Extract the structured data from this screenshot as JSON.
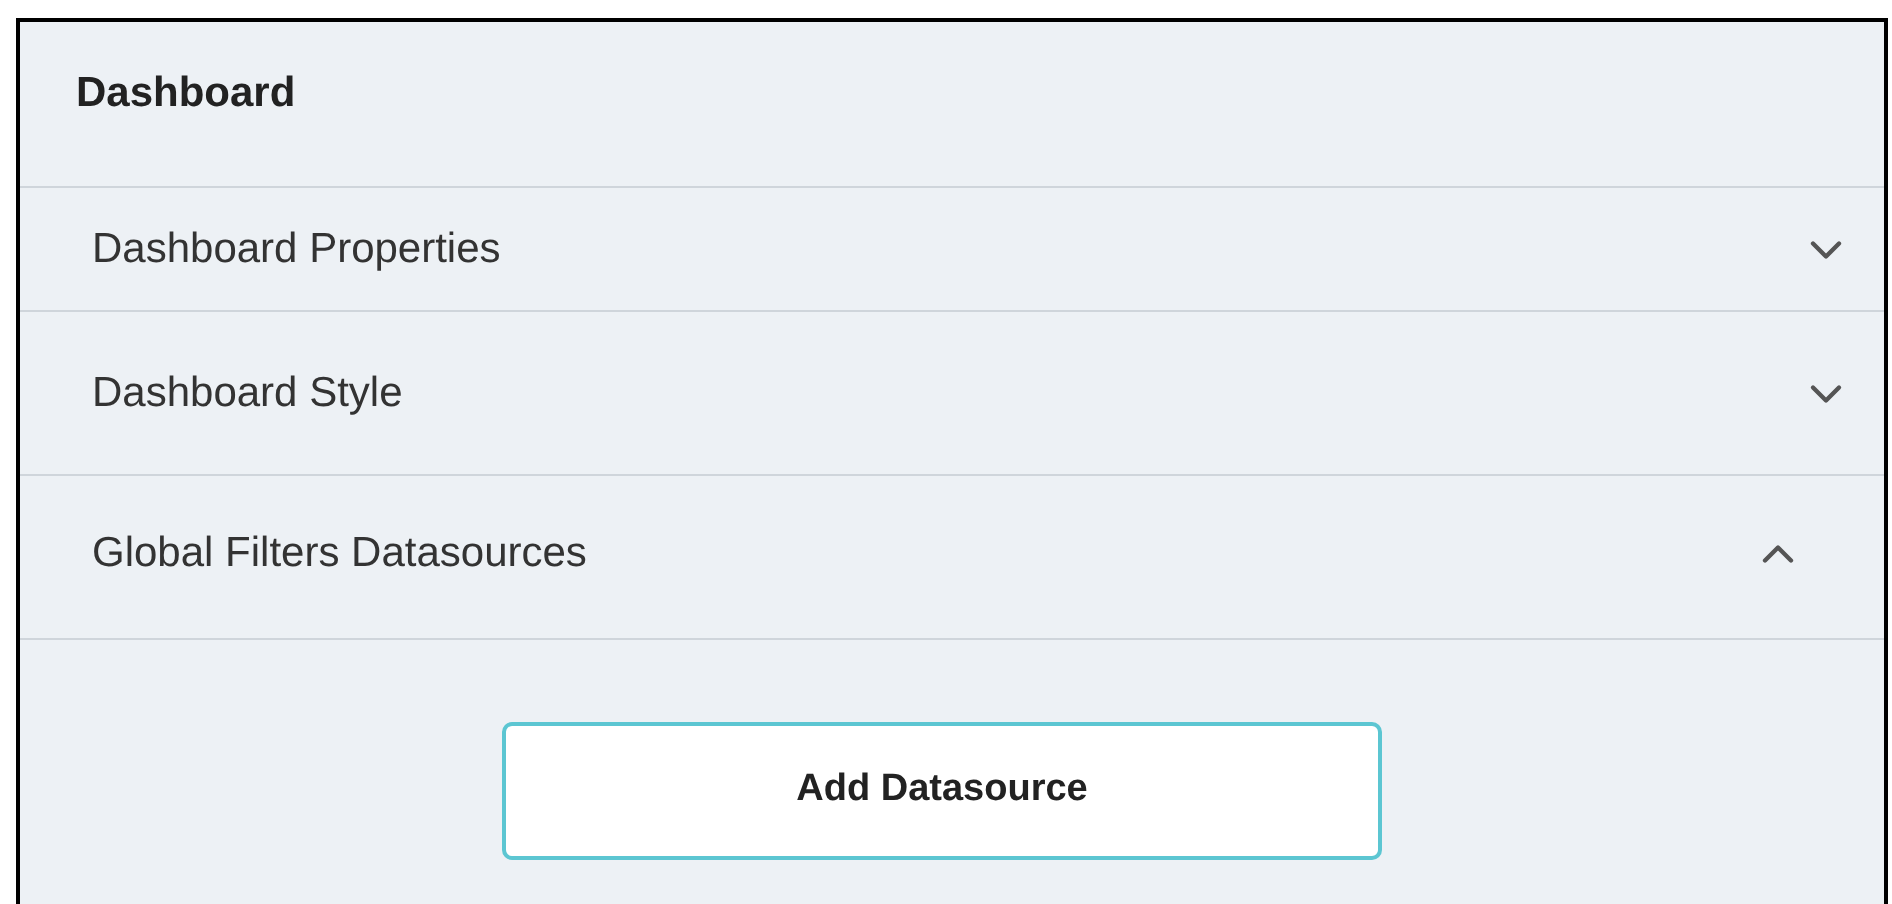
{
  "panel": {
    "title": "Dashboard"
  },
  "sections": [
    {
      "label": "Dashboard Properties",
      "expanded": false
    },
    {
      "label": "Dashboard Style",
      "expanded": false
    },
    {
      "label": "Global Filters Datasources",
      "expanded": true
    }
  ],
  "add_button": {
    "label": "Add Datasource"
  }
}
